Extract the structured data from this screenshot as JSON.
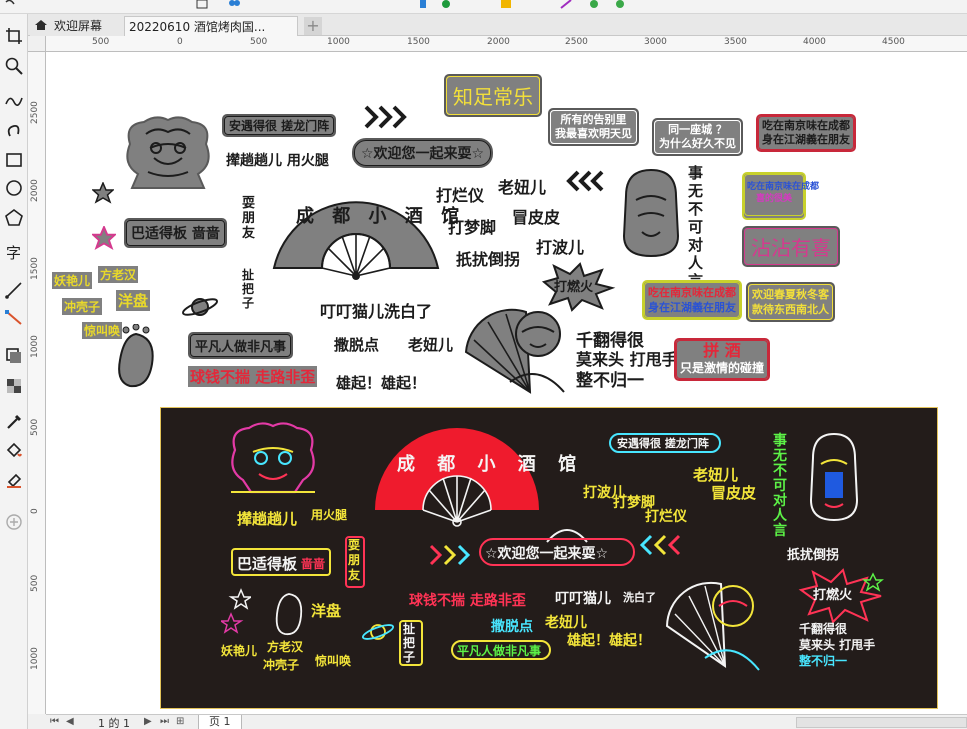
{
  "tabs": {
    "welcome": "欢迎屏幕",
    "document": "20220610 酒馆烤肉国...",
    "add": "+"
  },
  "ruler": {
    "h": [
      "500",
      "0",
      "500",
      "1000",
      "1500",
      "2000",
      "2500",
      "3000",
      "3500",
      "4000",
      "4500"
    ],
    "v": [
      "2500",
      "2000",
      "1500",
      "1000",
      "500",
      "0",
      "500",
      "1000"
    ]
  },
  "pagebar": {
    "of_label": "1 的 1",
    "page_tab": "页 1"
  },
  "stickers": {
    "anyu": "安遇得很 搓龙门阵",
    "zhizu": "知足常乐",
    "suoyou1": "所有的告别里",
    "suoyou2": "我最喜欢明天见",
    "tongyi1": "同一座城 ？",
    "tongyi2": "为什么好久不见",
    "chizai1": "吃在南京味在成都",
    "chizai2": "身在江湖義在朋友",
    "pataer": "撵趟趟儿 用火腿",
    "huanying": "☆欢迎您一起来耍☆",
    "dalanyi": "打烂仪",
    "laoniuer": "老妞儿",
    "damengjiao": "打梦脚",
    "maopipi": "冒皮皮",
    "dipodao": "扺扰倒拐",
    "dabeer": "打波儿",
    "darenhuo": "打燃火",
    "bashi": "巴适得板 啬啬",
    "shuapengyou": "耍朋友",
    "chengdu": "成 都 小 酒 馆",
    "shiwu": "事无不可对人言",
    "pabazi": "扯把子",
    "yaoyaner": "妖艳儿",
    "fanglaohan": "方老汉",
    "chongkezi": "冲壳子",
    "yangpan": "洋盘",
    "jingjiao": "惊叫唤",
    "jiaoyin": "脚印 泥巴",
    "pingfan": "平凡人做非凡事",
    "dingding": "叮叮猫儿洗白了",
    "saqidian": "撒脱点",
    "laoniuer2": "老妞儿",
    "qiuqian": "球钱不揣 走路非歪",
    "xiongqi": "雄起！雄起！",
    "qianfan": "千翻得很",
    "molaitou": "莫来头 打甩手",
    "zhengbu": "整不归一",
    "zhanzhan": "沾沾有喜",
    "huanyingcd1": "欢迎春夏秋冬客",
    "huanyingcd2": "款待东西南北人",
    "pinjiu1": "拼 酒",
    "pinjiu2": "只是激情的碰撞",
    "chizai3": "吃在南京味在成都",
    "chizai4": "身在江湖義在朋友",
    "likewords1": "吃在南京味在成都",
    "likewords2": "喜的很美"
  },
  "board": {
    "pataer": "撵趟趟儿",
    "huotui": "用火腿",
    "bashi": "巴适得板",
    "qiqi": "啬啬",
    "shua": "耍朋友",
    "yangpan": "洋盘",
    "yaoyan": "妖艳儿",
    "fanglao": "方老汉",
    "chongke": "冲壳子",
    "jingjiao": "惊叫唤",
    "paba": "扯把子",
    "pingfan": "平凡人做非凡事",
    "qiuqian": "球钱不揣 走路非歪",
    "saqi": "撒脱点",
    "laoniu": "老妞儿",
    "dingding": "叮叮猫儿",
    "xibai": "洗白了",
    "xiongqi": "雄起！雄起！",
    "chengdu": "成 都 小 酒 馆",
    "huanying": "☆欢迎您一起来耍☆",
    "anyu": "安遇得很 搓龙门阵",
    "dabo": "打波儿",
    "dameng": "打梦脚",
    "dalan": "打烂仪",
    "laoniu2": "老妞儿",
    "maopi": "冒皮皮",
    "shiwu": "事无不可对人言",
    "dipo": "扺扰倒拐",
    "daran": "打燃火",
    "qianfan": "千翻得很",
    "molai": "莫来头 打甩手",
    "zhengbu": "整不归一"
  }
}
